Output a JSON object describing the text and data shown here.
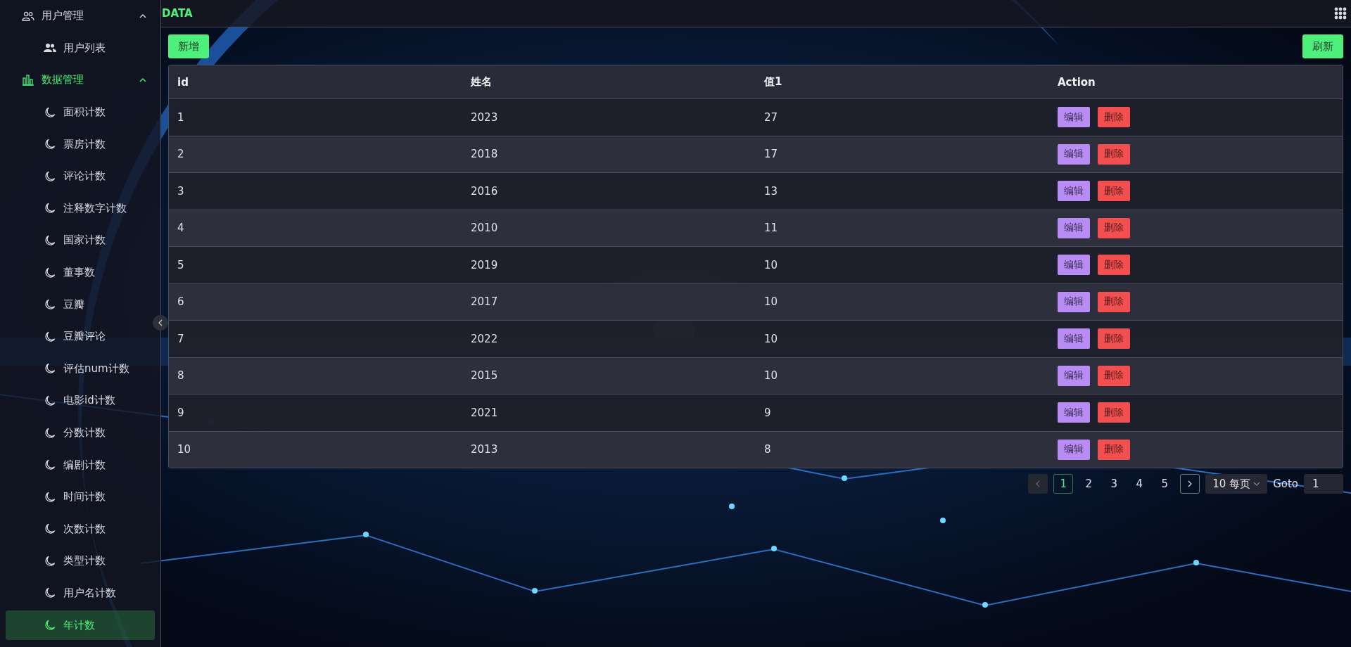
{
  "header": {
    "title": "DATA"
  },
  "sidebar": {
    "groups": [
      {
        "label": "用户管理",
        "kind": "users",
        "expanded": true,
        "active": false,
        "children": [
          {
            "label": "用户列表",
            "kind": "users-solid",
            "selected": false
          }
        ]
      },
      {
        "label": "数据管理",
        "kind": "chart",
        "expanded": true,
        "active": true,
        "children": [
          {
            "label": "面积计数",
            "kind": "moon",
            "selected": false
          },
          {
            "label": "票房计数",
            "kind": "moon",
            "selected": false
          },
          {
            "label": "评论计数",
            "kind": "moon",
            "selected": false
          },
          {
            "label": "注释数字计数",
            "kind": "moon",
            "selected": false
          },
          {
            "label": "国家计数",
            "kind": "moon",
            "selected": false
          },
          {
            "label": "董事数",
            "kind": "moon",
            "selected": false
          },
          {
            "label": "豆瓣",
            "kind": "moon",
            "selected": false
          },
          {
            "label": "豆瓣评论",
            "kind": "moon",
            "selected": false
          },
          {
            "label": "评估num计数",
            "kind": "moon",
            "selected": false
          },
          {
            "label": "电影id计数",
            "kind": "moon",
            "selected": false
          },
          {
            "label": "分数计数",
            "kind": "moon",
            "selected": false
          },
          {
            "label": "编剧计数",
            "kind": "moon",
            "selected": false
          },
          {
            "label": "时间计数",
            "kind": "moon",
            "selected": false
          },
          {
            "label": "次数计数",
            "kind": "moon",
            "selected": false
          },
          {
            "label": "类型计数",
            "kind": "moon",
            "selected": false
          },
          {
            "label": "用户名计数",
            "kind": "moon",
            "selected": false
          },
          {
            "label": "年计数",
            "kind": "moon",
            "selected": true
          }
        ]
      }
    ]
  },
  "toolbar": {
    "add": "新增",
    "refresh": "刷新"
  },
  "table": {
    "columns": [
      "id",
      "姓名",
      "值1",
      "Action"
    ],
    "rows": [
      {
        "cells": [
          "1",
          "2023",
          "27"
        ],
        "actions": [
          {
            "label": "编辑",
            "kind": "edit"
          },
          {
            "label": "删除",
            "kind": "delete"
          }
        ]
      },
      {
        "cells": [
          "2",
          "2018",
          "17"
        ],
        "actions": [
          {
            "label": "编辑",
            "kind": "edit"
          },
          {
            "label": "删除",
            "kind": "delete"
          }
        ]
      },
      {
        "cells": [
          "3",
          "2016",
          "13"
        ],
        "actions": [
          {
            "label": "编辑",
            "kind": "edit"
          },
          {
            "label": "删除",
            "kind": "delete"
          }
        ]
      },
      {
        "cells": [
          "4",
          "2010",
          "11"
        ],
        "actions": [
          {
            "label": "编辑",
            "kind": "edit"
          },
          {
            "label": "删除",
            "kind": "delete"
          }
        ]
      },
      {
        "cells": [
          "5",
          "2019",
          "10"
        ],
        "actions": [
          {
            "label": "编辑",
            "kind": "edit"
          },
          {
            "label": "删除",
            "kind": "delete"
          }
        ]
      },
      {
        "cells": [
          "6",
          "2017",
          "10"
        ],
        "actions": [
          {
            "label": "编辑",
            "kind": "edit"
          },
          {
            "label": "删除",
            "kind": "delete"
          }
        ]
      },
      {
        "cells": [
          "7",
          "2022",
          "10"
        ],
        "actions": [
          {
            "label": "编辑",
            "kind": "edit"
          },
          {
            "label": "删除",
            "kind": "delete"
          }
        ]
      },
      {
        "cells": [
          "8",
          "2015",
          "10"
        ],
        "actions": [
          {
            "label": "编辑",
            "kind": "edit"
          },
          {
            "label": "删除",
            "kind": "delete"
          }
        ]
      },
      {
        "cells": [
          "9",
          "2021",
          "9"
        ],
        "actions": [
          {
            "label": "编辑",
            "kind": "edit"
          },
          {
            "label": "删除",
            "kind": "delete"
          }
        ]
      },
      {
        "cells": [
          "10",
          "2013",
          "8"
        ],
        "actions": [
          {
            "label": "编辑",
            "kind": "edit"
          },
          {
            "label": "删除",
            "kind": "delete"
          }
        ]
      }
    ]
  },
  "pagination": {
    "prev_disabled": true,
    "next_disabled": false,
    "pages": [
      {
        "label": "1",
        "selected": true
      },
      {
        "label": "2",
        "selected": false
      },
      {
        "label": "3",
        "selected": false
      },
      {
        "label": "4",
        "selected": false
      },
      {
        "label": "5",
        "selected": false
      }
    ],
    "page_size": "10 每页",
    "goto_label": "Goto",
    "goto_value": "1"
  }
}
